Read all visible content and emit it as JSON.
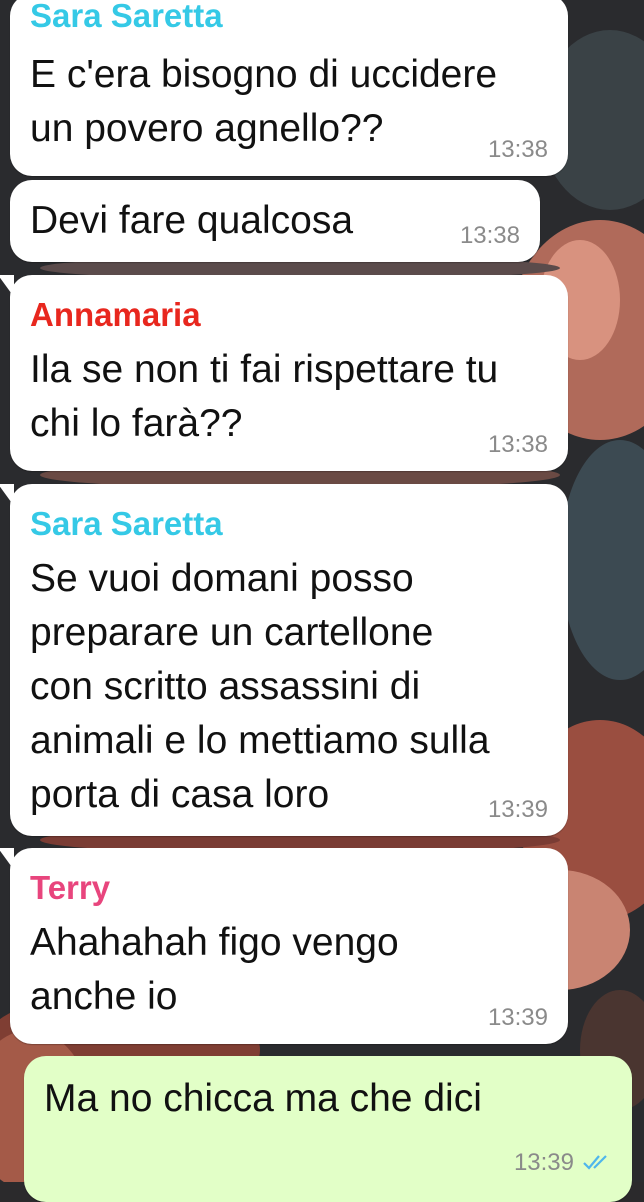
{
  "messages": [
    {
      "sender": "Sara Saretta",
      "sender_color": "#35c9e6",
      "lines": [
        "E c'era bisogno di uccidere",
        "un povero agnello??"
      ],
      "time": "13:38"
    },
    {
      "sender": "",
      "lines": [
        "Devi fare qualcosa"
      ],
      "time": "13:38"
    },
    {
      "sender": "Annamaria",
      "sender_color": "#e8271e",
      "lines": [
        "Ila se non ti fai rispettare tu",
        "chi lo farà??"
      ],
      "time": "13:38"
    },
    {
      "sender": "Sara Saretta",
      "sender_color": "#35c9e6",
      "lines": [
        "Se vuoi domani posso",
        "preparare un cartellone",
        "con scritto assassini di",
        "animali e lo mettiamo sulla",
        "porta di casa loro"
      ],
      "time": "13:39"
    },
    {
      "sender": "Terry",
      "sender_color": "#e8457d",
      "lines": [
        "Ahahahah figo vengo",
        "anche io"
      ],
      "time": "13:39"
    },
    {
      "sender": "",
      "lines": [
        "Ma no chicca ma che dici"
      ],
      "time": "13:39",
      "status_icon": "double-check-read-icon",
      "status_color": "#4fb6ec"
    }
  ]
}
